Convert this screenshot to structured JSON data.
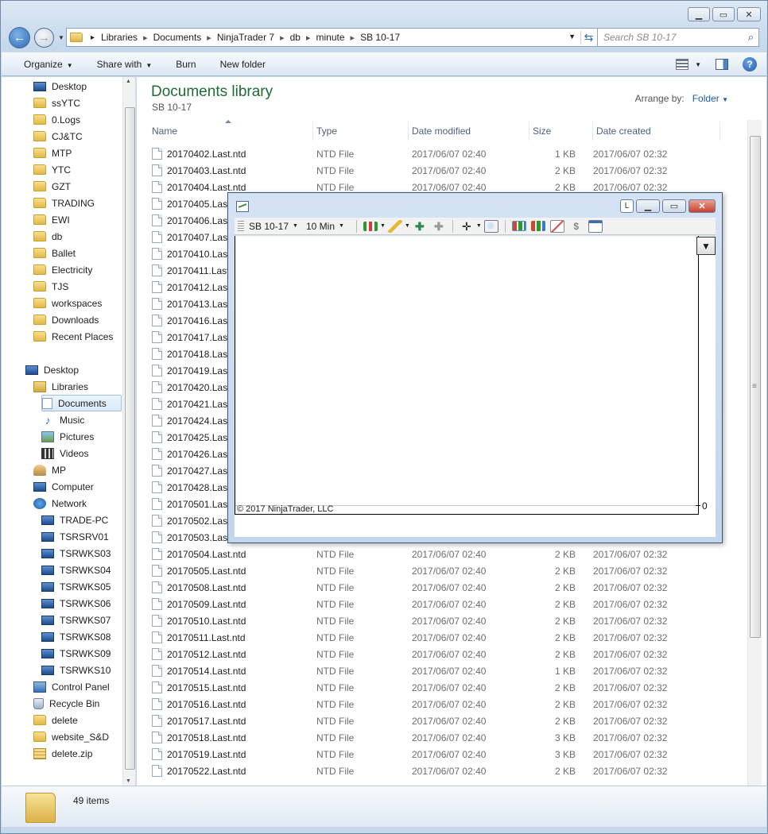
{
  "window": {
    "caption_buttons": [
      "minimize",
      "maximize",
      "close"
    ]
  },
  "address": {
    "crumbs": [
      "Libraries",
      "Documents",
      "NinjaTrader 7",
      "db",
      "minute",
      "SB 10-17"
    ]
  },
  "search": {
    "placeholder": "Search SB 10-17"
  },
  "commandbar": {
    "organize": "Organize",
    "share_with": "Share with",
    "burn": "Burn",
    "new_folder": "New folder"
  },
  "nav": {
    "favorites": [
      {
        "label": "Desktop",
        "icon": "desktop-icon"
      },
      {
        "label": "ssYTC",
        "icon": "folder-icon"
      },
      {
        "label": "0.Logs",
        "icon": "folder-icon"
      },
      {
        "label": "CJ&TC",
        "icon": "folder-icon"
      },
      {
        "label": "MTP",
        "icon": "folder-icon"
      },
      {
        "label": "YTC",
        "icon": "folder-icon"
      },
      {
        "label": "GZT",
        "icon": "folder-icon"
      },
      {
        "label": "TRADING",
        "icon": "folder-icon"
      },
      {
        "label": "EWI",
        "icon": "folder-icon"
      },
      {
        "label": "db",
        "icon": "folder-icon"
      },
      {
        "label": "Ballet",
        "icon": "folder-icon"
      },
      {
        "label": "Electricity",
        "icon": "folder-icon"
      },
      {
        "label": "TJS",
        "icon": "folder-icon"
      },
      {
        "label": "workspaces",
        "icon": "folder-icon"
      },
      {
        "label": "Downloads",
        "icon": "downloads-icon"
      },
      {
        "label": "Recent Places",
        "icon": "recent-places-icon"
      }
    ],
    "tree": [
      {
        "label": "Desktop",
        "icon": "desktop-icon",
        "indent": 0
      },
      {
        "label": "Libraries",
        "icon": "libraries-icon",
        "indent": 1
      },
      {
        "label": "Documents",
        "icon": "documents-icon",
        "indent": 2,
        "selected": true
      },
      {
        "label": "Music",
        "icon": "music-icon",
        "indent": 2
      },
      {
        "label": "Pictures",
        "icon": "pictures-icon",
        "indent": 2
      },
      {
        "label": "Videos",
        "icon": "videos-icon",
        "indent": 2
      },
      {
        "label": "MP",
        "icon": "user-icon",
        "indent": 1
      },
      {
        "label": "Computer",
        "icon": "computer-icon",
        "indent": 1
      },
      {
        "label": "Network",
        "icon": "network-icon",
        "indent": 1
      },
      {
        "label": "TRADE-PC",
        "icon": "computer-icon",
        "indent": 2
      },
      {
        "label": "TSRSRV01",
        "icon": "computer-icon",
        "indent": 2
      },
      {
        "label": "TSRWKS03",
        "icon": "computer-icon",
        "indent": 2
      },
      {
        "label": "TSRWKS04",
        "icon": "computer-icon",
        "indent": 2
      },
      {
        "label": "TSRWKS05",
        "icon": "computer-icon",
        "indent": 2
      },
      {
        "label": "TSRWKS06",
        "icon": "computer-icon",
        "indent": 2
      },
      {
        "label": "TSRWKS07",
        "icon": "computer-icon",
        "indent": 2
      },
      {
        "label": "TSRWKS08",
        "icon": "computer-icon",
        "indent": 2
      },
      {
        "label": "TSRWKS09",
        "icon": "computer-icon",
        "indent": 2
      },
      {
        "label": "TSRWKS10",
        "icon": "computer-icon",
        "indent": 2
      },
      {
        "label": "Control Panel",
        "icon": "control-panel-icon",
        "indent": 1
      },
      {
        "label": "Recycle Bin",
        "icon": "recycle-bin-icon",
        "indent": 1
      },
      {
        "label": "delete",
        "icon": "folder-icon",
        "indent": 1
      },
      {
        "label": "website_S&D",
        "icon": "folder-icon",
        "indent": 1
      },
      {
        "label": "delete.zip",
        "icon": "zip-icon",
        "indent": 1
      }
    ]
  },
  "library": {
    "title": "Documents library",
    "subtitle": "SB 10-17",
    "arrange_label": "Arrange by:",
    "arrange_value": "Folder"
  },
  "columns": [
    "Name",
    "Type",
    "Date modified",
    "Size",
    "Date created"
  ],
  "files": [
    {
      "name": "20170402.Last.ntd",
      "type": "NTD File",
      "modified": "2017/06/07 02:40",
      "size": "1 KB",
      "created": "2017/06/07 02:32"
    },
    {
      "name": "20170403.Last.ntd",
      "type": "NTD File",
      "modified": "2017/06/07 02:40",
      "size": "2 KB",
      "created": "2017/06/07 02:32"
    },
    {
      "name": "20170404.Last.ntd",
      "type": "NTD File",
      "modified": "2017/06/07 02:40",
      "size": "2 KB",
      "created": "2017/06/07 02:32"
    },
    {
      "name": "20170405.Last.ntd",
      "type": "",
      "modified": "",
      "size": "",
      "created": ""
    },
    {
      "name": "20170406.Last.ntd",
      "type": "",
      "modified": "",
      "size": "",
      "created": ""
    },
    {
      "name": "20170407.Last.ntd",
      "type": "",
      "modified": "",
      "size": "",
      "created": ""
    },
    {
      "name": "20170410.Last.ntd",
      "type": "",
      "modified": "",
      "size": "",
      "created": ""
    },
    {
      "name": "20170411.Last.ntd",
      "type": "",
      "modified": "",
      "size": "",
      "created": ""
    },
    {
      "name": "20170412.Last.ntd",
      "type": "",
      "modified": "",
      "size": "",
      "created": ""
    },
    {
      "name": "20170413.Last.ntd",
      "type": "",
      "modified": "",
      "size": "",
      "created": ""
    },
    {
      "name": "20170416.Last.ntd",
      "type": "",
      "modified": "",
      "size": "",
      "created": ""
    },
    {
      "name": "20170417.Last.ntd",
      "type": "",
      "modified": "",
      "size": "",
      "created": ""
    },
    {
      "name": "20170418.Last.ntd",
      "type": "",
      "modified": "",
      "size": "",
      "created": ""
    },
    {
      "name": "20170419.Last.ntd",
      "type": "",
      "modified": "",
      "size": "",
      "created": ""
    },
    {
      "name": "20170420.Last.ntd",
      "type": "",
      "modified": "",
      "size": "",
      "created": ""
    },
    {
      "name": "20170421.Last.ntd",
      "type": "",
      "modified": "",
      "size": "",
      "created": ""
    },
    {
      "name": "20170424.Last.ntd",
      "type": "",
      "modified": "",
      "size": "",
      "created": ""
    },
    {
      "name": "20170425.Last.ntd",
      "type": "",
      "modified": "",
      "size": "",
      "created": ""
    },
    {
      "name": "20170426.Last.ntd",
      "type": "",
      "modified": "",
      "size": "",
      "created": ""
    },
    {
      "name": "20170427.Last.ntd",
      "type": "",
      "modified": "",
      "size": "",
      "created": ""
    },
    {
      "name": "20170428.Last.ntd",
      "type": "",
      "modified": "",
      "size": "",
      "created": ""
    },
    {
      "name": "20170501.Last.ntd",
      "type": "",
      "modified": "",
      "size": "",
      "created": ""
    },
    {
      "name": "20170502.Last.ntd",
      "type": "",
      "modified": "",
      "size": "",
      "created": ""
    },
    {
      "name": "20170503.Last.ntd",
      "type": "",
      "modified": "",
      "size": "",
      "created": ""
    },
    {
      "name": "20170504.Last.ntd",
      "type": "NTD File",
      "modified": "2017/06/07 02:40",
      "size": "2 KB",
      "created": "2017/06/07 02:32"
    },
    {
      "name": "20170505.Last.ntd",
      "type": "NTD File",
      "modified": "2017/06/07 02:40",
      "size": "2 KB",
      "created": "2017/06/07 02:32"
    },
    {
      "name": "20170508.Last.ntd",
      "type": "NTD File",
      "modified": "2017/06/07 02:40",
      "size": "2 KB",
      "created": "2017/06/07 02:32"
    },
    {
      "name": "20170509.Last.ntd",
      "type": "NTD File",
      "modified": "2017/06/07 02:40",
      "size": "2 KB",
      "created": "2017/06/07 02:32"
    },
    {
      "name": "20170510.Last.ntd",
      "type": "NTD File",
      "modified": "2017/06/07 02:40",
      "size": "2 KB",
      "created": "2017/06/07 02:32"
    },
    {
      "name": "20170511.Last.ntd",
      "type": "NTD File",
      "modified": "2017/06/07 02:40",
      "size": "2 KB",
      "created": "2017/06/07 02:32"
    },
    {
      "name": "20170512.Last.ntd",
      "type": "NTD File",
      "modified": "2017/06/07 02:40",
      "size": "2 KB",
      "created": "2017/06/07 02:32"
    },
    {
      "name": "20170514.Last.ntd",
      "type": "NTD File",
      "modified": "2017/06/07 02:40",
      "size": "1 KB",
      "created": "2017/06/07 02:32"
    },
    {
      "name": "20170515.Last.ntd",
      "type": "NTD File",
      "modified": "2017/06/07 02:40",
      "size": "2 KB",
      "created": "2017/06/07 02:32"
    },
    {
      "name": "20170516.Last.ntd",
      "type": "NTD File",
      "modified": "2017/06/07 02:40",
      "size": "2 KB",
      "created": "2017/06/07 02:32"
    },
    {
      "name": "20170517.Last.ntd",
      "type": "NTD File",
      "modified": "2017/06/07 02:40",
      "size": "2 KB",
      "created": "2017/06/07 02:32"
    },
    {
      "name": "20170518.Last.ntd",
      "type": "NTD File",
      "modified": "2017/06/07 02:40",
      "size": "3 KB",
      "created": "2017/06/07 02:32"
    },
    {
      "name": "20170519.Last.ntd",
      "type": "NTD File",
      "modified": "2017/06/07 02:40",
      "size": "3 KB",
      "created": "2017/06/07 02:32"
    },
    {
      "name": "20170522.Last.ntd",
      "type": "NTD File",
      "modified": "2017/06/07 02:40",
      "size": "2 KB",
      "created": "2017/06/07 02:32"
    }
  ],
  "status": {
    "item_count": "49 items"
  },
  "chart": {
    "instrument": "SB 10-17",
    "interval": "10 Min",
    "copyright": "© 2017 NinjaTrader, LLC",
    "axis_value": "0",
    "title_btn": "L"
  },
  "colors": {
    "library_title": "#1e6b34",
    "link_blue": "#1e5aa6"
  }
}
